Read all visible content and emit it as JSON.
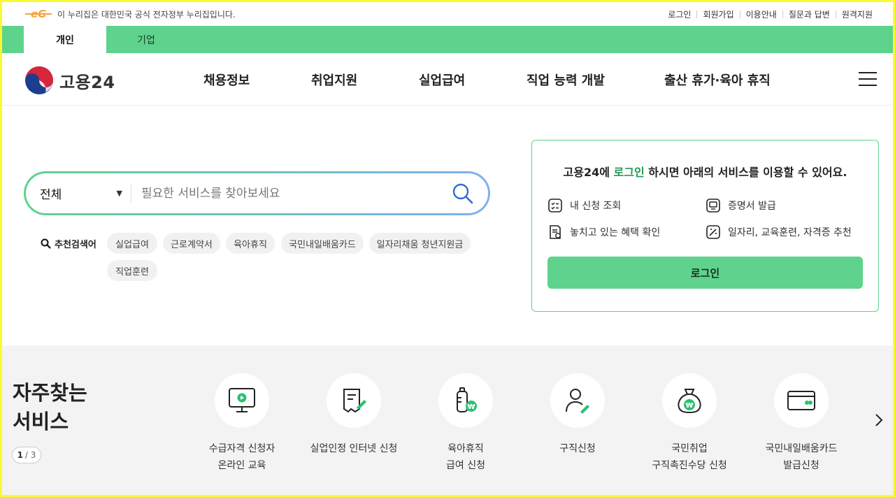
{
  "notice": {
    "logo_text": "eG",
    "text": "이 누리집은 대한민국 공식 전자정부 누리집입니다."
  },
  "util_links": [
    "로그인",
    "회원가입",
    "이용안내",
    "질문과 답변",
    "원격지원"
  ],
  "tabs": [
    {
      "label": "개인",
      "active": true
    },
    {
      "label": "기업",
      "active": false
    }
  ],
  "brand": {
    "name": "고용24"
  },
  "gnb": [
    "채용정보",
    "취업지원",
    "실업급여",
    "직업 능력 개발",
    "출산 휴가·육아 휴직"
  ],
  "search": {
    "scope": "전체",
    "placeholder": "필요한 서비스를 찾아보세요"
  },
  "recommended": {
    "label": "추천검색어",
    "keywords": [
      "실업급여",
      "근로계약서",
      "육아휴직",
      "국민내일배움카드",
      "일자리채움 청년지원금",
      "직업훈련"
    ]
  },
  "login_box": {
    "title_pre": "고용24에 ",
    "title_hl": "로그인",
    "title_post": " 하시면 아래의 서비스를 이용할 수 있어요.",
    "services": [
      "내 신청 조회",
      "증명서 발급",
      "놓치고 있는 혜택 확인",
      "일자리, 교육훈련, 자격증 추천"
    ],
    "button": "로그인"
  },
  "frequent": {
    "title_line1": "자주찾는",
    "title_line2": "서비스",
    "pager_current": "1",
    "pager_rest": "/ 3",
    "items": [
      {
        "line1": "수급자격 신청자",
        "line2": "온라인 교육",
        "icon": "monitor-play-icon"
      },
      {
        "line1": "실업인정 인터넷 신청",
        "line2": "",
        "icon": "document-pen-icon"
      },
      {
        "line1": "육아휴직",
        "line2": "급여 신청",
        "icon": "baby-bottle-won-icon"
      },
      {
        "line1": "구직신청",
        "line2": "",
        "icon": "person-pen-icon"
      },
      {
        "line1": "국민취업",
        "line2": "구직촉진수당 신청",
        "icon": "money-bag-won-icon"
      },
      {
        "line1": "국민내일배움카드",
        "line2": "발급신청",
        "icon": "card-icon"
      }
    ]
  },
  "colors": {
    "green": "#5fd38d",
    "green_text": "#1e9a52",
    "blue": "#2d6ad6",
    "gray_bg": "#f3f3f3"
  }
}
